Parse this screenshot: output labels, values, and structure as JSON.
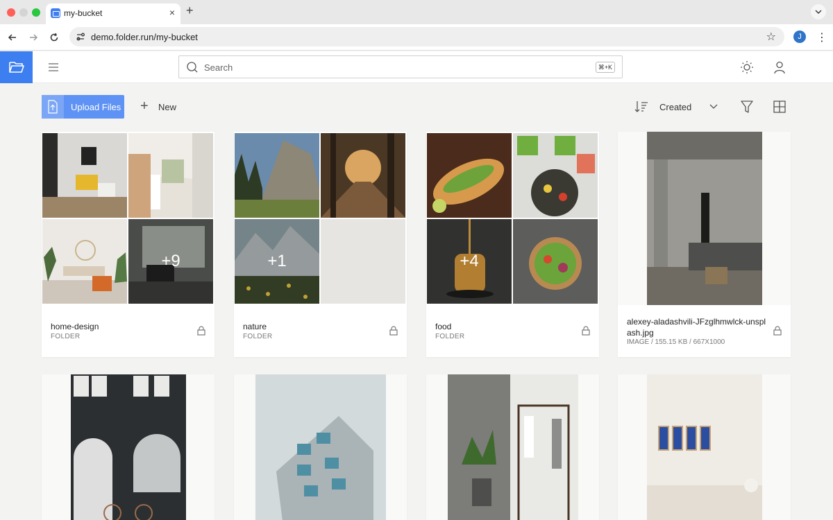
{
  "browser": {
    "tab_title": "my-bucket",
    "tab_close": "×",
    "new_tab": "+",
    "url": "demo.folder.run/my-bucket",
    "profile_initial": "J",
    "bookmark_star": "☆",
    "menu_dots": "⋮"
  },
  "header": {
    "search_placeholder": "Search",
    "search_shortcut": "⌘+K"
  },
  "toolbar": {
    "upload_label": "Upload Files",
    "new_label": "New",
    "sort_label": "Created"
  },
  "folders": [
    {
      "name": "home-design",
      "type": "FOLDER",
      "more_count": "+9"
    },
    {
      "name": "nature",
      "type": "FOLDER",
      "more_count": "+1"
    },
    {
      "name": "food",
      "type": "FOLDER",
      "more_count": "+4"
    }
  ],
  "image_file": {
    "name": "alexey-aladashvili-JFzglhmwlck-unsplash.jpg",
    "meta": "IMAGE / 155.15 KB / 667X1000"
  },
  "colors": {
    "accent": "#3d7ff0",
    "upload_button": "#5e92f4",
    "background": "#f3f3f2"
  },
  "icons": [
    "folder-open-icon",
    "menu-icon",
    "search-icon",
    "sun-icon",
    "user-icon",
    "upload-icon",
    "plus-icon",
    "sort-icon",
    "chevron-down-icon",
    "filter-icon",
    "grid-view-icon",
    "lock-icon"
  ]
}
